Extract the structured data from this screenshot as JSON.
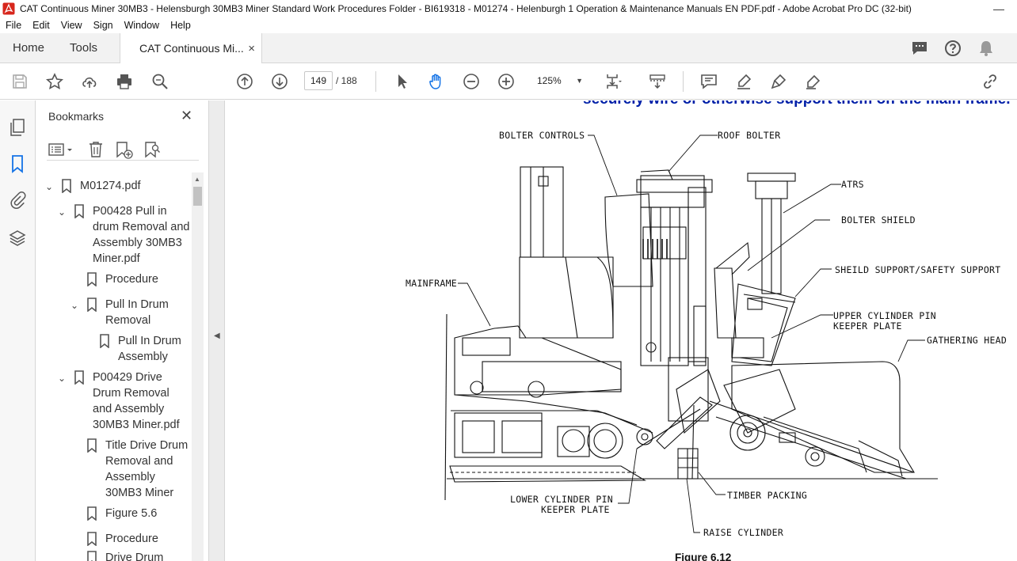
{
  "window": {
    "title": "CAT Continuous Miner 30MB3 - Helensburgh 30MB3 Miner Standard Work Procedures Folder - BI619318 - M01274 - Helenburgh 1 Operation & Maintenance Manuals EN PDF.pdf - Adobe Acrobat Pro DC (32-bit)",
    "minimize": "—"
  },
  "menu": [
    "File",
    "Edit",
    "View",
    "Sign",
    "Window",
    "Help"
  ],
  "tabs": {
    "home": "Home",
    "tools": "Tools",
    "document": "CAT Continuous Mi...",
    "close": "×"
  },
  "toolbar": {
    "current_page": "149",
    "page_total": "/ 188",
    "zoom": "125%"
  },
  "bookmarks": {
    "title": "Bookmarks",
    "close": "✕",
    "items": [
      {
        "label": "M01274.pdf"
      },
      {
        "label": "P00428 Pull in drum Removal and Assembly 30MB3 Miner.pdf"
      },
      {
        "label": "Procedure"
      },
      {
        "label": "Pull In Drum Removal"
      },
      {
        "label": "Pull In Drum Assembly"
      },
      {
        "label": "P00429 Drive Drum Removal and Assembly 30MB3 Miner.pdf"
      },
      {
        "label": "Title Drive Drum Removal and Assembly 30MB3 Miner"
      },
      {
        "label": "Figure 5.6"
      },
      {
        "label": "Procedure"
      },
      {
        "label": "Drive Drum"
      }
    ]
  },
  "document": {
    "heading_partial": "securely wire or otherwise support them on the main frame.",
    "callouts": {
      "bolter_controls": "BOLTER CONTROLS",
      "roof_bolter": "ROOF BOLTER",
      "atrs": "ATRS",
      "bolter_shield": "BOLTER SHIELD",
      "shield_support": "SHEILD SUPPORT/SAFETY SUPPORT",
      "mainframe": "MAINFRAME",
      "upper_cyl_1": "UPPER CYLINDER PIN",
      "upper_cyl_2": "KEEPER PLATE",
      "gathering_head": "GATHERING HEAD",
      "lower_cyl_1": "LOWER CYLINDER PIN",
      "lower_cyl_2": "KEEPER PLATE",
      "timber_packing": "TIMBER PACKING",
      "raise_cylinder": "RAISE CYLINDER"
    },
    "figure_caption": "Figure 6.12"
  },
  "colors": {
    "heading_blue": "#0020a8",
    "acrobat_red": "#d7261c",
    "accent_blue": "#1473e6"
  }
}
